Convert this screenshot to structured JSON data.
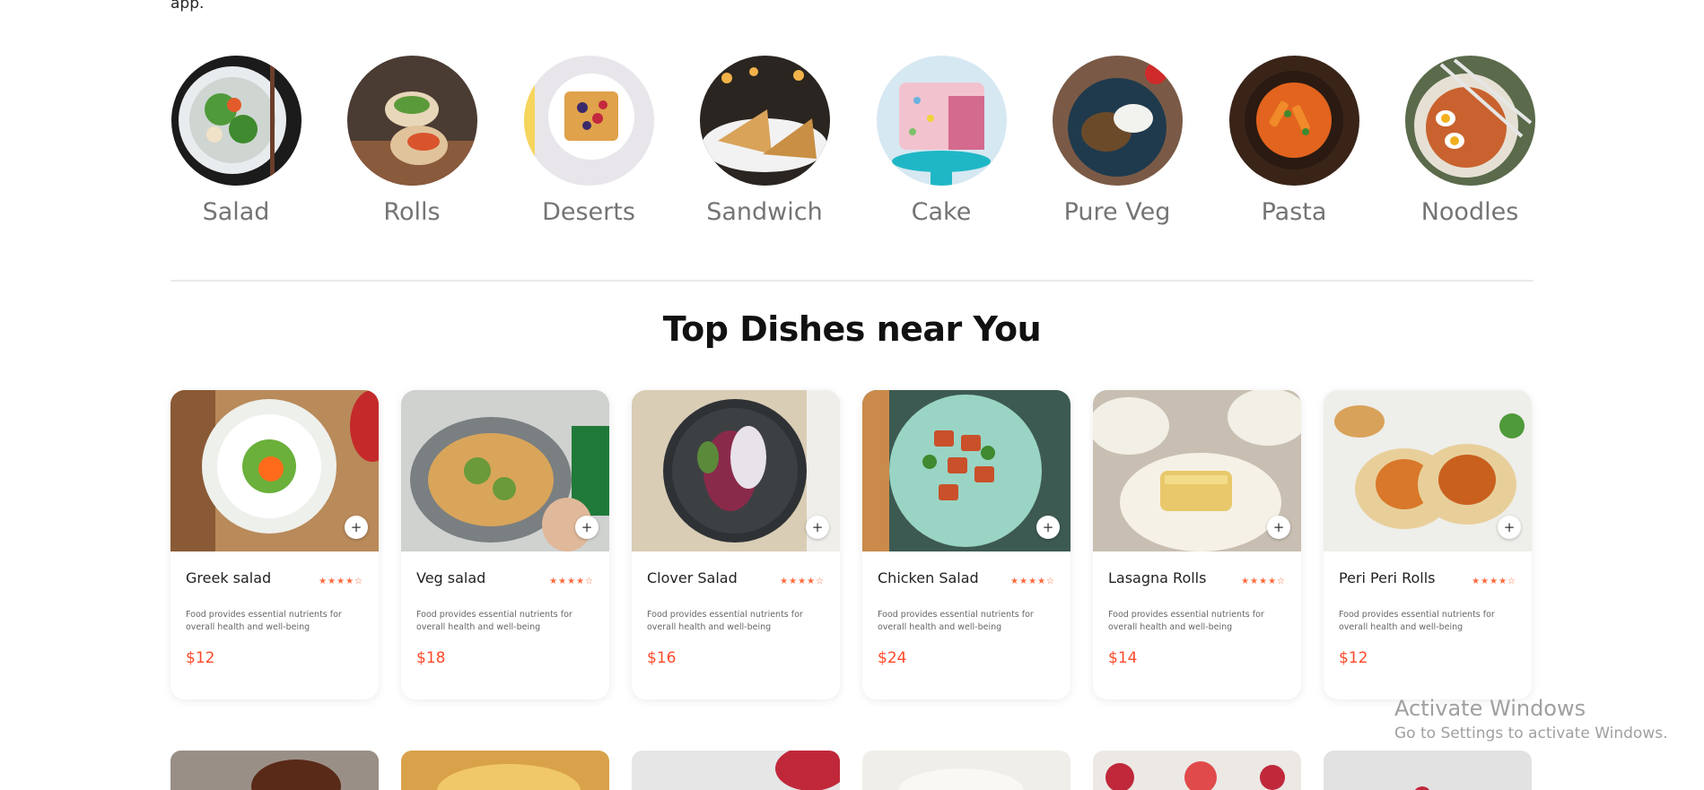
{
  "intro_tail": "app.",
  "categories": [
    {
      "label": "Salad",
      "icon": "salad-image"
    },
    {
      "label": "Rolls",
      "icon": "rolls-image"
    },
    {
      "label": "Deserts",
      "icon": "desserts-image"
    },
    {
      "label": "Sandwich",
      "icon": "sandwich-image"
    },
    {
      "label": "Cake",
      "icon": "cake-image"
    },
    {
      "label": "Pure Veg",
      "icon": "pure-veg-image"
    },
    {
      "label": "Pasta",
      "icon": "pasta-image"
    },
    {
      "label": "Noodles",
      "icon": "noodles-image"
    }
  ],
  "section_title": "Top Dishes near You",
  "dishes": [
    {
      "name": "Greek salad",
      "desc": "Food provides essential nutrients for overall health and well-being",
      "price": "$12",
      "rating": 4
    },
    {
      "name": "Veg salad",
      "desc": "Food provides essential nutrients for overall health and well-being",
      "price": "$18",
      "rating": 4
    },
    {
      "name": "Clover Salad",
      "desc": "Food provides essential nutrients for overall health and well-being",
      "price": "$16",
      "rating": 4
    },
    {
      "name": "Chicken Salad",
      "desc": "Food provides essential nutrients for overall health and well-being",
      "price": "$24",
      "rating": 4
    },
    {
      "name": "Lasagna Rolls",
      "desc": "Food provides essential nutrients for overall health and well-being",
      "price": "$14",
      "rating": 4
    },
    {
      "name": "Peri Peri Rolls",
      "desc": "Food provides essential nutrients for overall health and well-being",
      "price": "$12",
      "rating": 4
    }
  ],
  "add_button_symbol": "+",
  "stars_text": "★★★★☆",
  "colors": {
    "accent": "#ff4a2a",
    "star": "#ff6a3d"
  },
  "watermark": {
    "title": "Activate Windows",
    "subtitle": "Go to Settings to activate Windows."
  }
}
